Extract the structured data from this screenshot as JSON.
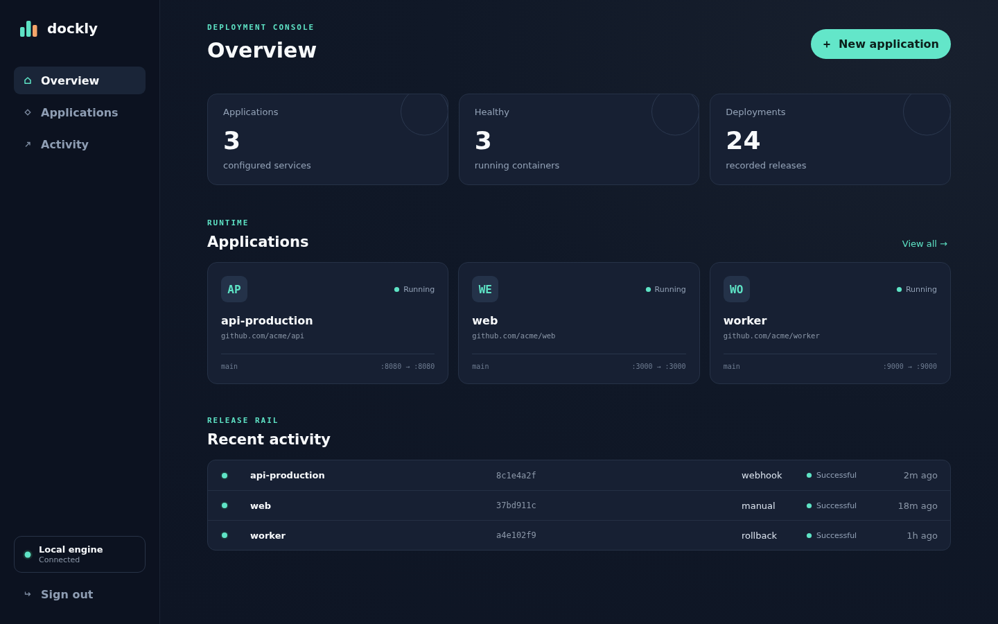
{
  "sidebar": {
    "brand": "dockly",
    "nav": [
      {
        "label": "Overview",
        "selected": true
      },
      {
        "label": "Applications",
        "selected": false
      },
      {
        "label": "Activity",
        "selected": false
      }
    ],
    "engine": {
      "name": "Local engine",
      "status": "Connected"
    },
    "sign_out": "Sign out"
  },
  "header": {
    "eyebrow": "DEPLOYMENT CONSOLE",
    "title": "Overview",
    "action": "New application"
  },
  "stats": [
    {
      "label": "Applications",
      "value": "3",
      "caption": "configured services"
    },
    {
      "label": "Healthy",
      "value": "3",
      "caption": "running containers"
    },
    {
      "label": "Deployments",
      "value": "24",
      "caption": "recorded releases"
    }
  ],
  "applications": {
    "eyebrow": "RUNTIME",
    "title": "Applications",
    "link": "View all →",
    "items": [
      {
        "initials": "AP",
        "status": "Running",
        "name": "api-production",
        "repo": "github.com/acme/api",
        "branch": "main",
        "ports": ":8080 → :8080"
      },
      {
        "initials": "WE",
        "status": "Running",
        "name": "web",
        "repo": "github.com/acme/web",
        "branch": "main",
        "ports": ":3000 → :3000"
      },
      {
        "initials": "WO",
        "status": "Running",
        "name": "worker",
        "repo": "github.com/acme/worker",
        "branch": "main",
        "ports": ":9000 → :9000"
      }
    ]
  },
  "activity": {
    "eyebrow": "RELEASE RAIL",
    "title": "Recent activity",
    "rows": [
      {
        "app": "api-production",
        "commit": "8c1e4a2f",
        "trigger": "webhook",
        "status": "Successful",
        "time": "2m ago"
      },
      {
        "app": "web",
        "commit": "37bd911c",
        "trigger": "manual",
        "status": "Successful",
        "time": "18m ago"
      },
      {
        "app": "worker",
        "commit": "a4e102f9",
        "trigger": "rollback",
        "status": "Successful",
        "time": "1h ago"
      }
    ]
  }
}
